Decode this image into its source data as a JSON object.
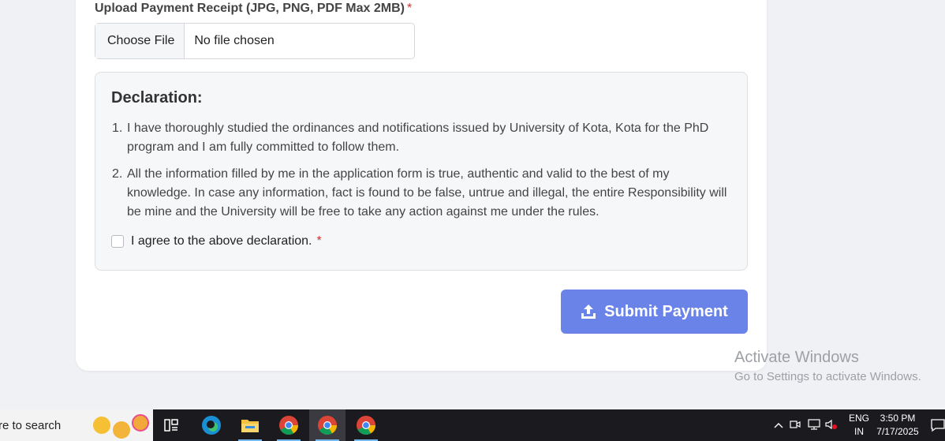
{
  "upload": {
    "label": "Upload Payment Receipt (JPG, PNG, PDF Max 2MB)",
    "required_mark": "*",
    "choose_button": "Choose File",
    "status": "No file chosen"
  },
  "declaration": {
    "heading": "Declaration:",
    "items": [
      {
        "num": "1.",
        "text": "I have thoroughly studied the ordinances and notifications issued by University of Kota, Kota for the PhD program and I am fully committed to follow them."
      },
      {
        "num": "2.",
        "text": "All the information filled by me in the application form is true, authentic and valid to the best of my knowledge. In case any information, fact is found to be false, untrue and illegal, the entire Responsibility will be mine and the University will be free to take any action against me under the rules."
      }
    ],
    "agree_label": "I agree to the above declaration.",
    "agree_checked": false,
    "required_mark": "*"
  },
  "submit": {
    "label": "Submit Payment",
    "icon": "upload-icon",
    "color": "#6a83e9"
  },
  "watermark": {
    "title": "Activate Windows",
    "subtitle": "Go to Settings to activate Windows."
  },
  "taskbar": {
    "search_text": "re to search",
    "apps": [
      "task-view-icon",
      "edge-icon",
      "file-explorer-icon",
      "chrome-icon",
      "chrome-icon",
      "chrome-icon"
    ],
    "lang_top": "ENG",
    "lang_bottom": "IN",
    "time": "3:50 PM",
    "date": "7/17/2025"
  }
}
